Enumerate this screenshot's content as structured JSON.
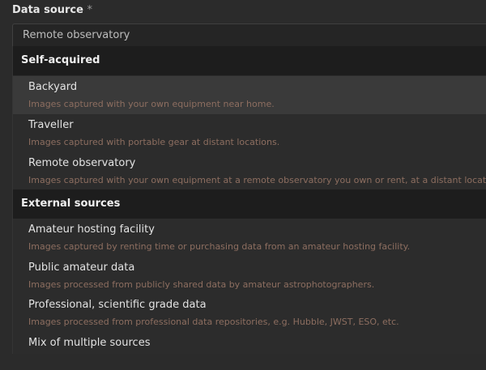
{
  "field": {
    "label": "Data source",
    "required_marker": "*"
  },
  "select": {
    "value": "Remote observatory"
  },
  "groups": [
    {
      "header": "Self-acquired",
      "options": [
        {
          "label": "Backyard",
          "description": "Images captured with your own equipment near home.",
          "selected": true
        },
        {
          "label": "Traveller",
          "description": "Images captured with portable gear at distant locations."
        },
        {
          "label": "Remote observatory",
          "description": "Images captured with your own equipment at a remote observatory you own or rent, at a distant location."
        }
      ]
    },
    {
      "header": "External sources",
      "options": [
        {
          "label": "Amateur hosting facility",
          "description": "Images captured by renting time or purchasing data from an amateur hosting facility."
        },
        {
          "label": "Public amateur data",
          "description": "Images processed from publicly shared data by amateur astrophotographers."
        },
        {
          "label": "Professional, scientific grade data",
          "description": "Images processed from professional data repositories, e.g. Hubble, JWST, ESO, etc."
        },
        {
          "label": "Mix of multiple sources",
          "description": ""
        }
      ]
    }
  ]
}
